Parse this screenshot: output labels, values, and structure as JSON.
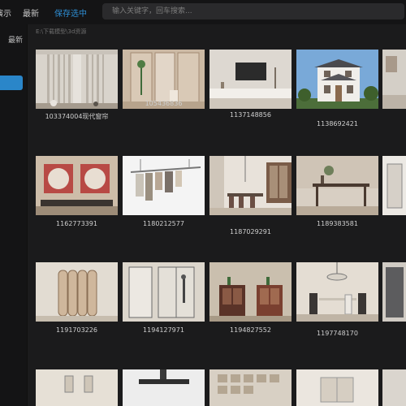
{
  "header": {
    "tabs": [
      {
        "label": "演示"
      },
      {
        "label": "最新"
      },
      {
        "label": "保存选中"
      }
    ],
    "search_placeholder": "输入关键字，回车搜索..."
  },
  "sidebar": {
    "item_label": "最新"
  },
  "breadcrumb": "E:\\下载模型\\3d资源",
  "colors": {
    "accent": "#2e8fd6",
    "sidebar_active": "#2a86c9",
    "background": "#1b1b1c",
    "topbar": "#141415"
  },
  "grid": {
    "captions": [
      "103374004现代窗帘",
      "105436836",
      "1137148856",
      "1138692421",
      "",
      "1162773391",
      "1180212577",
      "1187029291",
      "1189383581",
      "",
      "1191703226",
      "1194127971",
      "1194827552",
      "1197748170",
      "",
      "",
      "",
      "",
      "",
      ""
    ]
  }
}
